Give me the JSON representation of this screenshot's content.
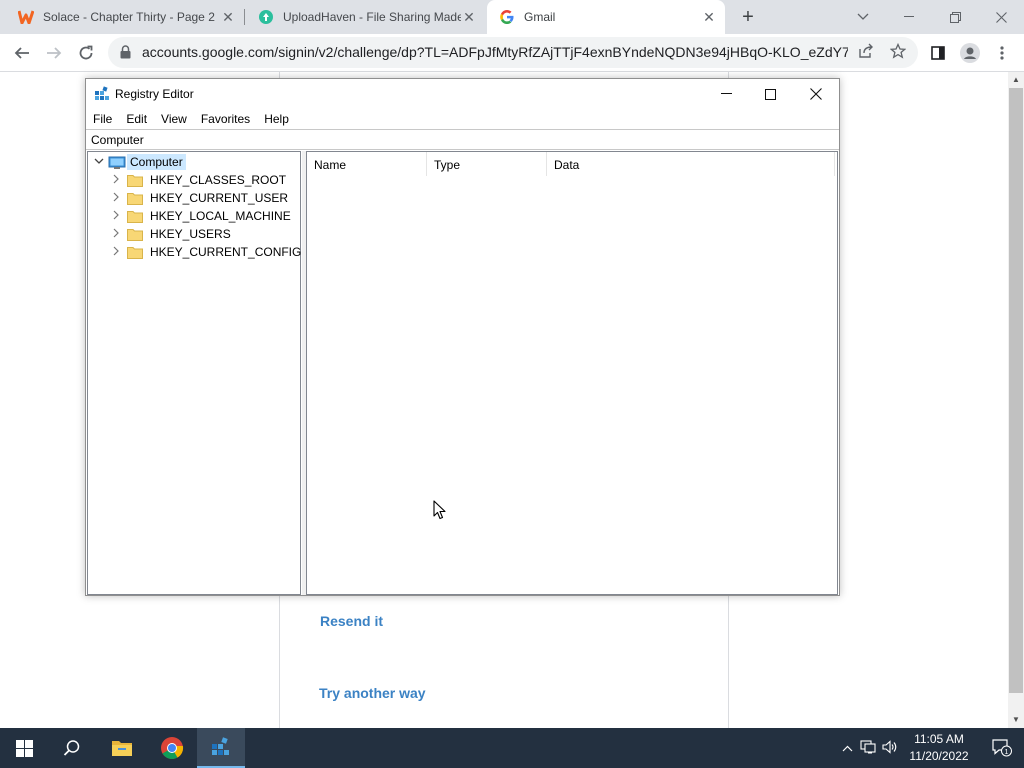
{
  "browser": {
    "tabs": [
      {
        "title": "Solace - Chapter Thirty - Page 2",
        "active": false,
        "favicon": "wattpad-icon"
      },
      {
        "title": "UploadHaven - File Sharing Made",
        "active": false,
        "favicon": "uploadhaven-icon"
      },
      {
        "title": "Gmail",
        "active": true,
        "favicon": "google-icon"
      }
    ],
    "url": "accounts.google.com/signin/v2/challenge/dp?TL=ADFpJfMtyRfZAjTTjF4exnBYndeNQDN3e94jHBqO-KLO_eZdY7s..."
  },
  "page": {
    "resend_link": "Resend it",
    "try_another_link": "Try another way"
  },
  "regedit": {
    "title": "Registry Editor",
    "menu": [
      "File",
      "Edit",
      "View",
      "Favorites",
      "Help"
    ],
    "address": "Computer",
    "tree_root": "Computer",
    "tree_items": [
      "HKEY_CLASSES_ROOT",
      "HKEY_CURRENT_USER",
      "HKEY_LOCAL_MACHINE",
      "HKEY_USERS",
      "HKEY_CURRENT_CONFIG"
    ],
    "columns": [
      "Name",
      "Type",
      "Data"
    ]
  },
  "taskbar": {
    "time": "11:05 AM",
    "date": "11/20/2022",
    "notification_count": "1"
  },
  "colors": {
    "link": "#3b82c4",
    "selection": "#cce8ff",
    "taskbar": "#233040"
  }
}
